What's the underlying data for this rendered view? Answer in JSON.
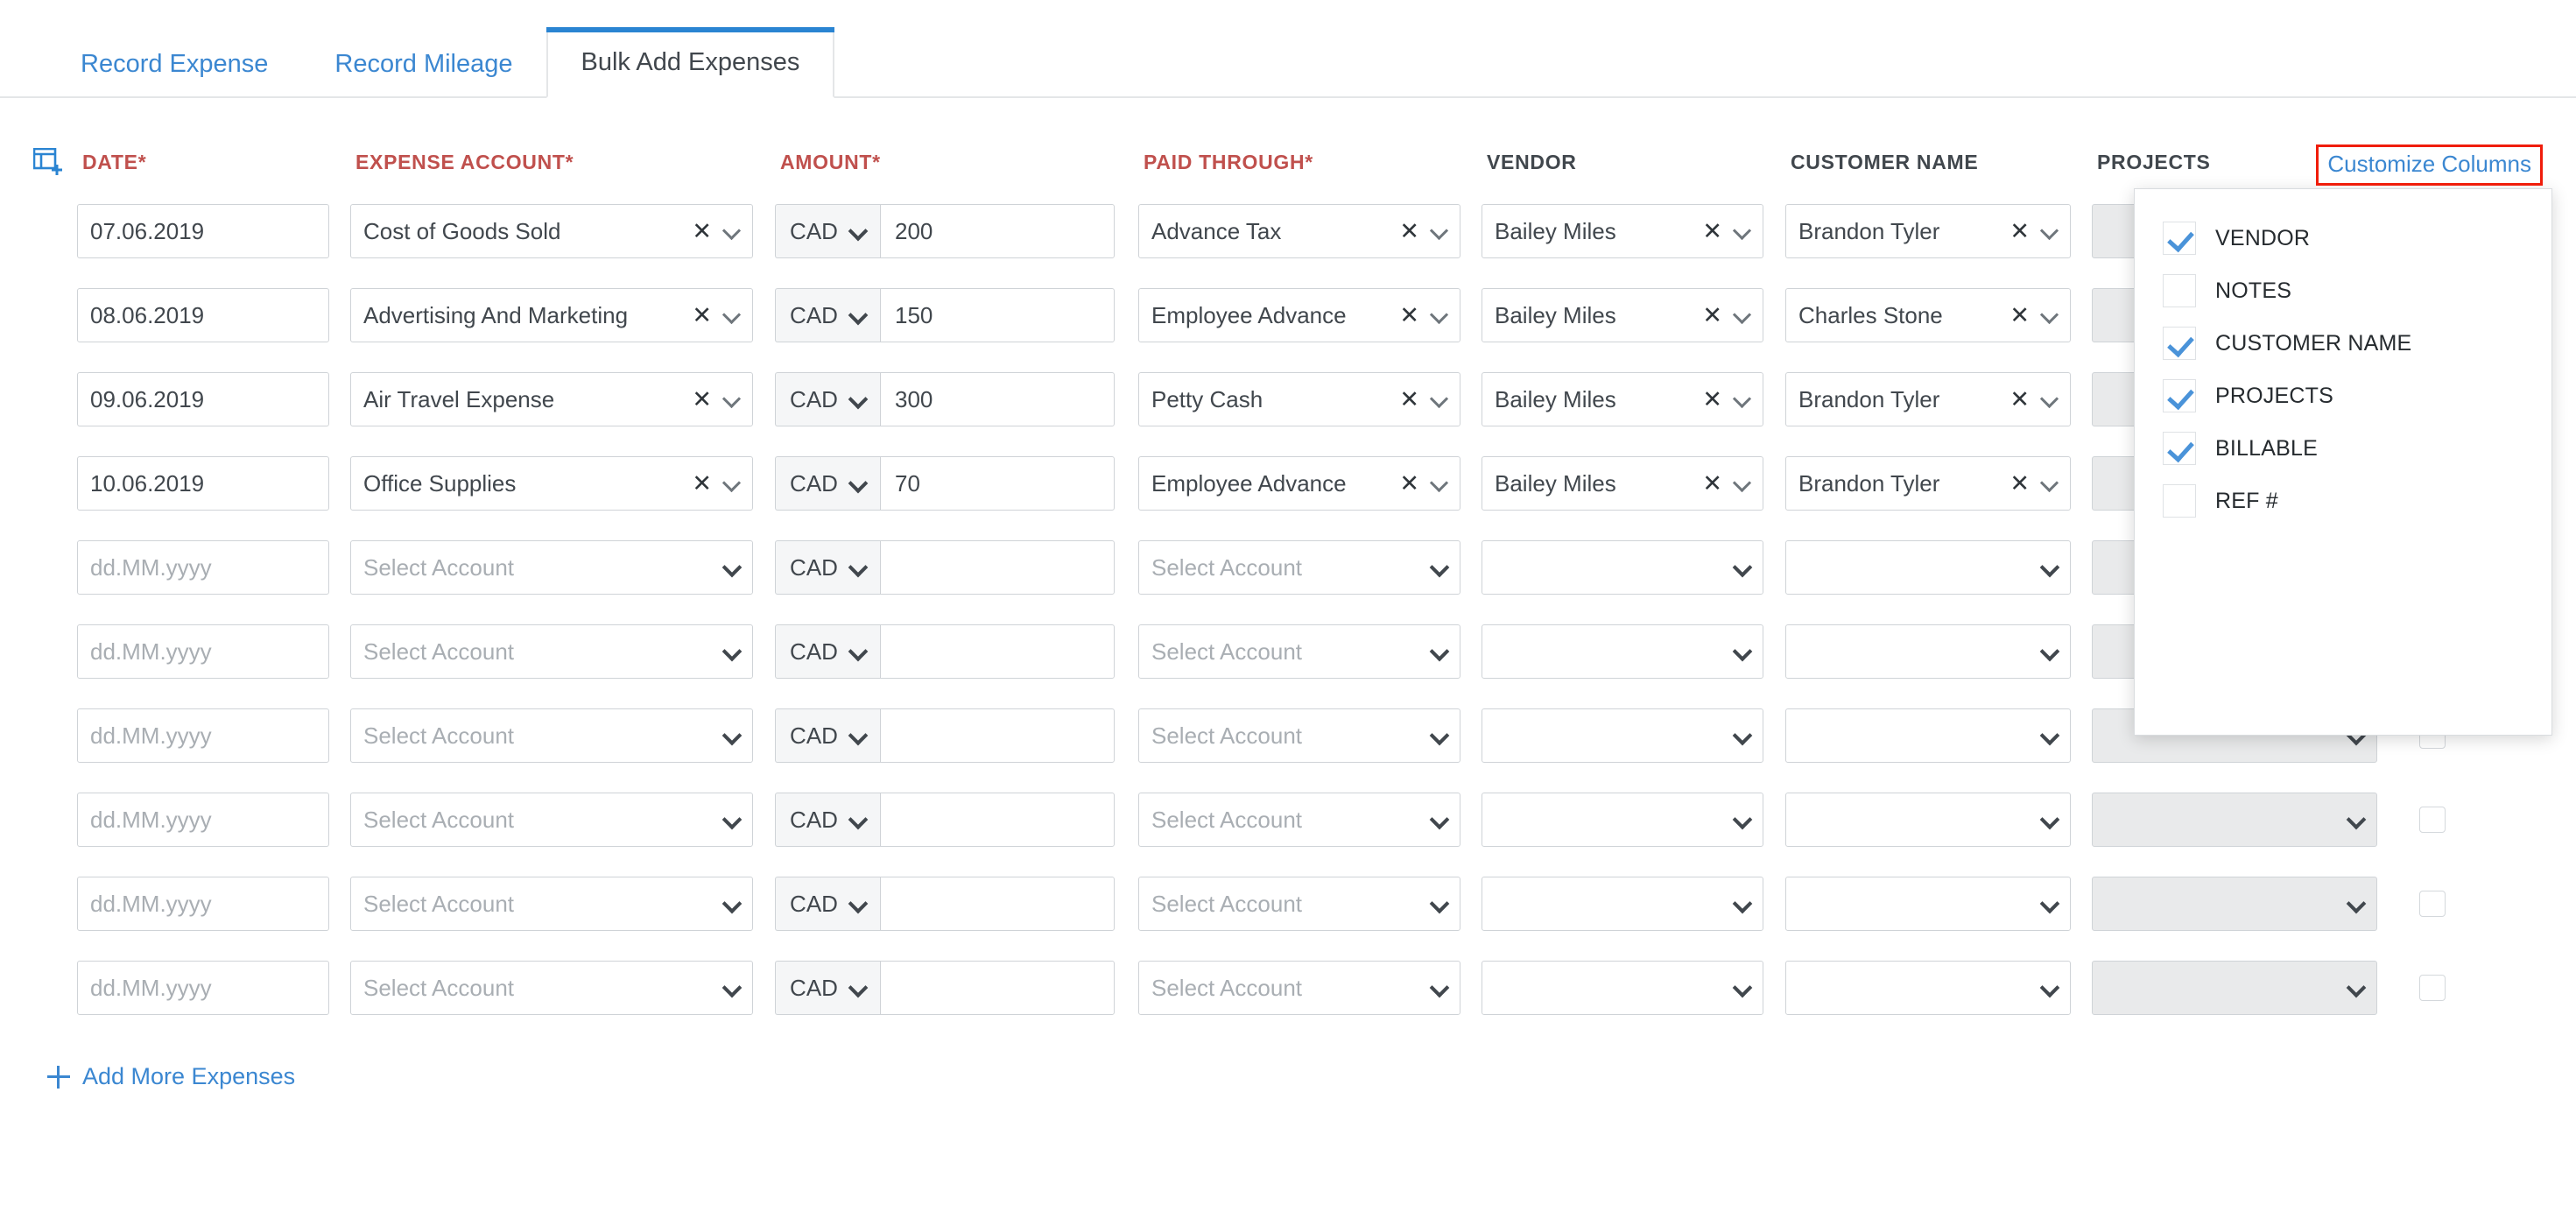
{
  "tabs": [
    {
      "label": "Record Expense",
      "active": false
    },
    {
      "label": "Record Mileage",
      "active": false
    },
    {
      "label": "Bulk Add Expenses",
      "active": true
    }
  ],
  "toolbar": {
    "customize_columns_label": "Customize Columns",
    "highlight_color": "#f01d0b",
    "link_color": "#3b87d1"
  },
  "customize_columns_menu": {
    "items": [
      {
        "label": "VENDOR",
        "checked": true
      },
      {
        "label": "NOTES",
        "checked": false
      },
      {
        "label": "CUSTOMER NAME",
        "checked": true
      },
      {
        "label": "PROJECTS",
        "checked": true
      },
      {
        "label": "BILLABLE",
        "checked": true
      },
      {
        "label": "REF #",
        "checked": false
      }
    ]
  },
  "grid": {
    "add_column_icon": "add-column-icon",
    "headers": [
      {
        "label": "DATE*",
        "required": true
      },
      {
        "label": "EXPENSE ACCOUNT*",
        "required": true
      },
      {
        "label": "AMOUNT*",
        "required": true
      },
      {
        "label": "PAID THROUGH*",
        "required": true
      },
      {
        "label": "VENDOR",
        "required": false
      },
      {
        "label": "CUSTOMER NAME",
        "required": false
      },
      {
        "label": "PROJECTS",
        "required": false
      }
    ],
    "required_color": "#c0504d",
    "header_color": "#41474d",
    "placeholders": {
      "date": "dd.MM.yyyy",
      "account": "Select Account",
      "vendor": "",
      "customer": "",
      "project": ""
    },
    "rows": [
      {
        "date": "07.06.2019",
        "expense_account": "Cost of Goods Sold",
        "currency": "CAD",
        "amount": "200",
        "paid_through": "Advance Tax",
        "vendor": "Bailey Miles",
        "customer_name": "Brandon Tyler",
        "project": "",
        "billable": false,
        "filled": true
      },
      {
        "date": "08.06.2019",
        "expense_account": "Advertising And Marketing",
        "currency": "CAD",
        "amount": "150",
        "paid_through": "Employee Advance",
        "vendor": "Bailey Miles",
        "customer_name": "Charles Stone",
        "project": "",
        "billable": false,
        "filled": true
      },
      {
        "date": "09.06.2019",
        "expense_account": "Air Travel Expense",
        "currency": "CAD",
        "amount": "300",
        "paid_through": "Petty Cash",
        "vendor": "Bailey Miles",
        "customer_name": "Brandon Tyler",
        "project": "",
        "billable": false,
        "filled": true
      },
      {
        "date": "10.06.2019",
        "expense_account": "Office Supplies",
        "currency": "CAD",
        "amount": "70",
        "paid_through": "Employee Advance",
        "vendor": "Bailey Miles",
        "customer_name": "Brandon Tyler",
        "project": "",
        "billable": false,
        "filled": true
      },
      {
        "date": "",
        "expense_account": "",
        "currency": "CAD",
        "amount": "",
        "paid_through": "",
        "vendor": "",
        "customer_name": "",
        "project": "",
        "billable": false,
        "filled": false
      },
      {
        "date": "",
        "expense_account": "",
        "currency": "CAD",
        "amount": "",
        "paid_through": "",
        "vendor": "",
        "customer_name": "",
        "project": "",
        "billable": false,
        "filled": false
      },
      {
        "date": "",
        "expense_account": "",
        "currency": "CAD",
        "amount": "",
        "paid_through": "",
        "vendor": "",
        "customer_name": "",
        "project": "",
        "billable": false,
        "filled": false
      },
      {
        "date": "",
        "expense_account": "",
        "currency": "CAD",
        "amount": "",
        "paid_through": "",
        "vendor": "",
        "customer_name": "",
        "project": "",
        "billable": false,
        "filled": false
      },
      {
        "date": "",
        "expense_account": "",
        "currency": "CAD",
        "amount": "",
        "paid_through": "",
        "vendor": "",
        "customer_name": "",
        "project": "",
        "billable": false,
        "filled": false
      },
      {
        "date": "",
        "expense_account": "",
        "currency": "CAD",
        "amount": "",
        "paid_through": "",
        "vendor": "",
        "customer_name": "",
        "project": "",
        "billable": false,
        "filled": false
      }
    ]
  },
  "footer": {
    "add_more_label": "Add More Expenses",
    "plus_icon": "plus-icon"
  }
}
